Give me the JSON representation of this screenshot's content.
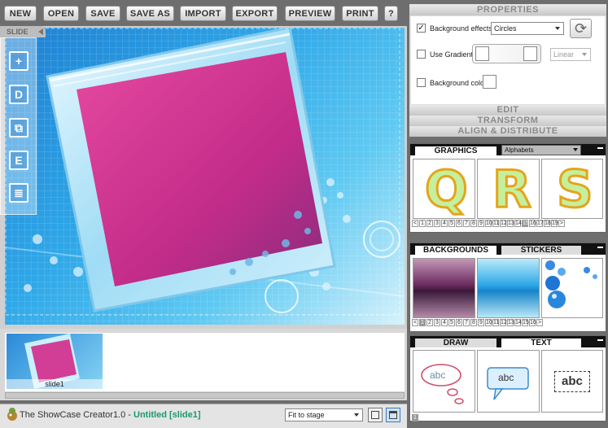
{
  "toolbar": {
    "buttons": [
      "NEW",
      "OPEN",
      "SAVE",
      "SAVE AS",
      "IMPORT",
      "EXPORT",
      "PREVIEW",
      "PRINT",
      "?"
    ]
  },
  "slide_panel": {
    "tab_label": "SLIDE",
    "tools": [
      "add-icon",
      "D",
      "duplicate-icon",
      "E",
      "print-icon"
    ]
  },
  "filmstrip": {
    "slides": [
      "slide1"
    ]
  },
  "status": {
    "app_name": "The ShowCase Creator1.0 - ",
    "document": "Untitled [slide1]",
    "zoom_value": "Fit to stage"
  },
  "properties": {
    "header": "PROPERTIES",
    "background_effects_label": "Background effects",
    "background_effects_checked": true,
    "effect_value": "Circles",
    "use_gradient_label": "Use Gradient",
    "gradient_type_value": "Linear",
    "background_color_label": "Background color",
    "sections": [
      "EDIT",
      "TRANSFORM",
      "ALIGN & DISTRIBUTE"
    ]
  },
  "graphics_panel": {
    "tab": "GRAPHICS",
    "category_value": "Alphabets",
    "letters": [
      "Q",
      "R",
      "S"
    ],
    "pages": [
      "<",
      "1",
      "2",
      "3",
      "4",
      "5",
      "6",
      "7",
      "8",
      "9",
      "10",
      "11",
      "12",
      "13",
      "14",
      "15",
      "16",
      "17",
      "18",
      "19",
      ">"
    ],
    "current_page": "15"
  },
  "backgrounds_panel": {
    "tabs": [
      "BACKGROUNDS",
      "STICKERS"
    ],
    "pages": [
      "<",
      "1",
      "2",
      "3",
      "4",
      "5",
      "6",
      "7",
      "8",
      "9",
      "10",
      "11",
      "12",
      "13",
      "14",
      "15",
      "16",
      ">"
    ],
    "current_page": "1"
  },
  "draw_panel": {
    "tabs": [
      "DRAW",
      "TEXT"
    ],
    "samples": [
      "abc",
      "abc",
      "abc"
    ],
    "pages": [
      "1"
    ],
    "current_page": "1"
  },
  "colors": {
    "stage_blue": "#2ea7e8",
    "frame_magenta": "#d9398f",
    "accent_green": "#1a9a6a"
  }
}
